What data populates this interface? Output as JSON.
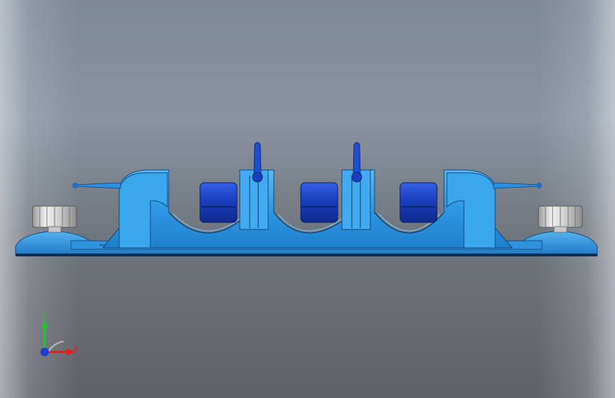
{
  "viewport": {
    "background": "#7f8896",
    "model_colors": {
      "body": "#2e9be6",
      "body_light": "#5fb9f0",
      "body_dark": "#1a6fb8",
      "inserts": "#1538b8",
      "knobs": "#d8d8d8"
    },
    "triad": {
      "y_label": "Y",
      "x_label": "X",
      "y_color": "#23c62a",
      "x_color": "#e0201c",
      "z_color": "#1f3fd0"
    }
  }
}
